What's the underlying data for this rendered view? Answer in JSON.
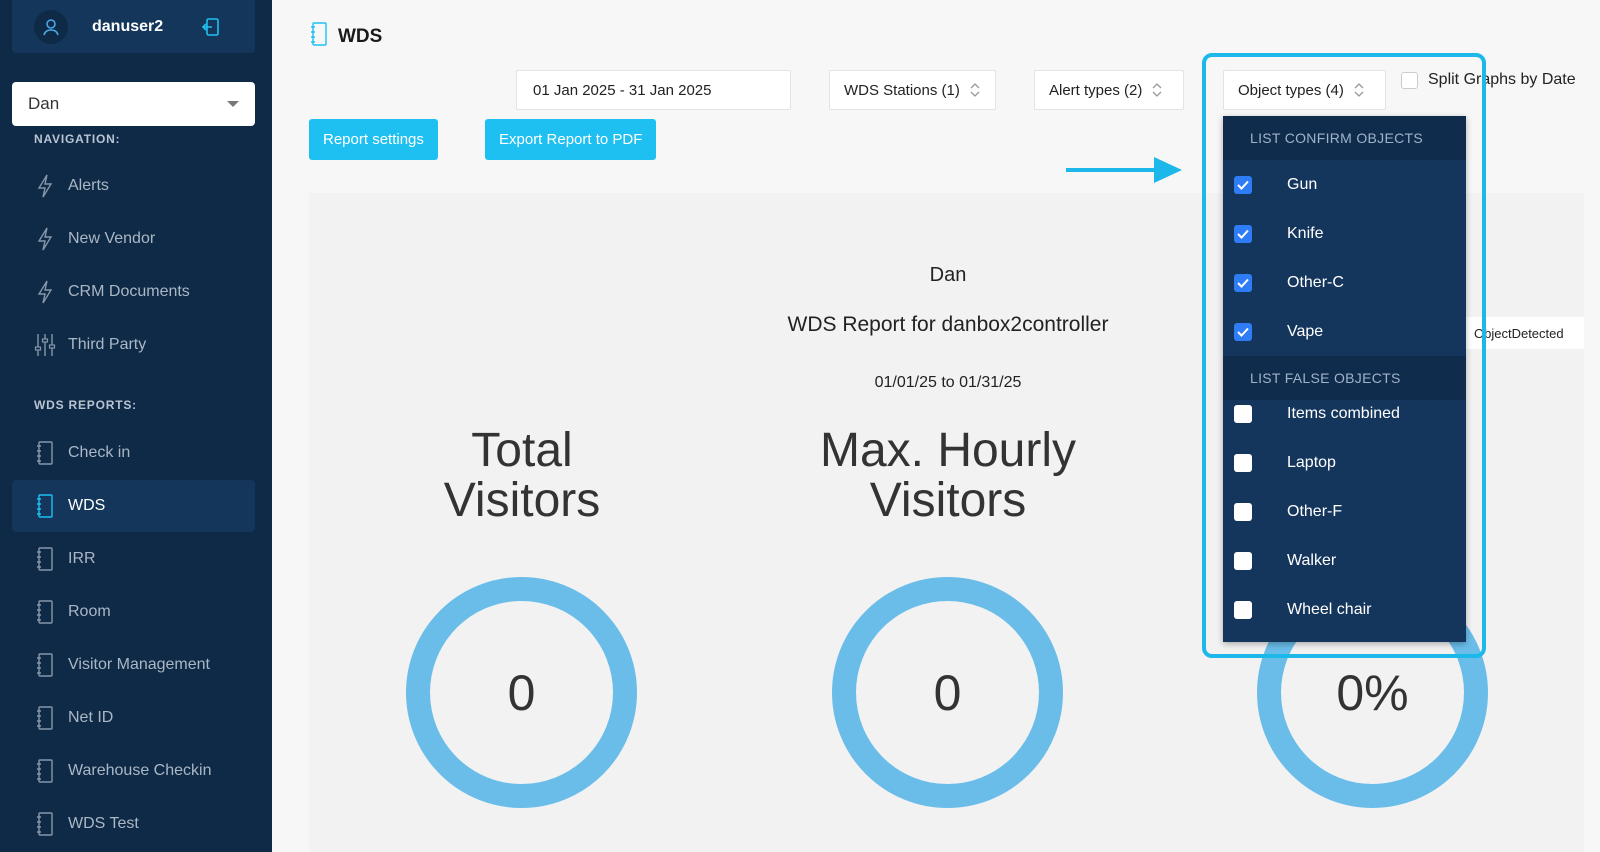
{
  "user": {
    "name": "danuser2"
  },
  "org_select": {
    "value": "Dan"
  },
  "sidebar": {
    "nav_title": "NAVIGATION:",
    "nav_items": [
      {
        "label": "Alerts",
        "icon": "bolt-icon"
      },
      {
        "label": "New Vendor",
        "icon": "bolt-icon"
      },
      {
        "label": "CRM Documents",
        "icon": "bolt-icon"
      },
      {
        "label": "Third Party",
        "icon": "sliders-icon"
      }
    ],
    "reports_title": "WDS REPORTS:",
    "report_items": [
      {
        "label": "Check in",
        "icon": "notebook-icon"
      },
      {
        "label": "WDS",
        "icon": "notebook-icon",
        "active": true
      },
      {
        "label": "IRR",
        "icon": "notebook-icon"
      },
      {
        "label": "Room",
        "icon": "notebook-icon"
      },
      {
        "label": "Visitor Management",
        "icon": "notebook-icon"
      },
      {
        "label": "Net ID",
        "icon": "notebook-icon"
      },
      {
        "label": "Warehouse Checkin",
        "icon": "notebook-icon"
      },
      {
        "label": "WDS Test",
        "icon": "notebook-icon"
      }
    ]
  },
  "header": {
    "title": "WDS"
  },
  "filters": {
    "date_range": "01 Jan 2025 - 31 Jan 2025",
    "stations": "WDS Stations (1)",
    "alert_types": "Alert types (2)",
    "object_types": "Object types (4)",
    "split_label": "Split Graphs by Date"
  },
  "buttons": {
    "settings": "Report settings",
    "export": "Export Report to PDF"
  },
  "report": {
    "org": "Dan",
    "title": "WDS Report for danbox2controller",
    "range": "01/01/25 to 01/31/25",
    "kpi1_label_line1": "Total",
    "kpi1_label_line2": "Visitors",
    "kpi1_value": "0",
    "kpi2_label_line1": "Max. Hourly",
    "kpi2_label_line2": "Visitors",
    "kpi2_value": "0",
    "kpi3_value": "0%",
    "side_label": "ObjectDetected"
  },
  "dropdown": {
    "confirm_header": "LIST CONFIRM OBJECTS",
    "confirm_items": [
      {
        "label": "Gun",
        "checked": true
      },
      {
        "label": "Knife",
        "checked": true
      },
      {
        "label": "Other-C",
        "checked": true
      },
      {
        "label": "Vape",
        "checked": true
      }
    ],
    "false_header": "LIST FALSE OBJECTS",
    "false_items": [
      {
        "label": "Items combined",
        "checked": false
      },
      {
        "label": "Laptop",
        "checked": false
      },
      {
        "label": "Other-F",
        "checked": false
      },
      {
        "label": "Walker",
        "checked": false
      },
      {
        "label": "Wheel chair",
        "checked": false
      }
    ]
  },
  "colors": {
    "sidebar": "#0f2a47",
    "accent": "#1ec0f2",
    "ring": "#6abde9",
    "checkbox": "#2f7df6"
  }
}
